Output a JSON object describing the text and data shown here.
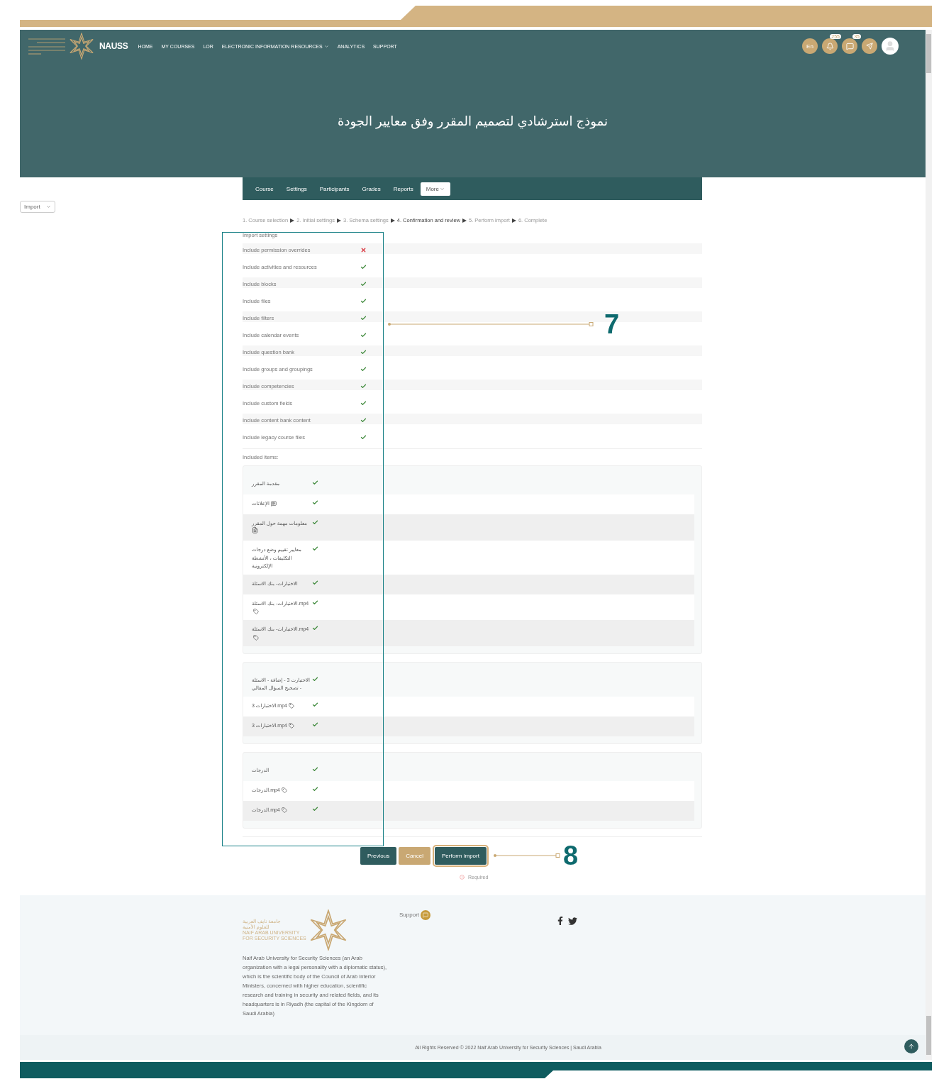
{
  "header": {
    "site_name": "NAUSS",
    "nav": [
      {
        "label": "HOME",
        "dropdown": false
      },
      {
        "label": "MY COURSES",
        "dropdown": false
      },
      {
        "label": "LOR",
        "dropdown": false
      },
      {
        "label": "ELECTRONIC INFORMATION RESOURCES",
        "dropdown": true
      },
      {
        "label": "ANALYTICS",
        "dropdown": false
      },
      {
        "label": "SUPPORT",
        "dropdown": false
      }
    ],
    "language": "En",
    "notifications": "255",
    "messages": "35"
  },
  "page_title": "نموذج استرشادي لتصميم المقرر وفق معايير الجودة",
  "course_nav": [
    {
      "label": "Course",
      "selected": false,
      "dropdown": false
    },
    {
      "label": "Settings",
      "selected": false,
      "dropdown": false
    },
    {
      "label": "Participants",
      "selected": false,
      "dropdown": false
    },
    {
      "label": "Grades",
      "selected": false,
      "dropdown": false
    },
    {
      "label": "Reports",
      "selected": false,
      "dropdown": false
    },
    {
      "label": "More",
      "selected": true,
      "dropdown": true
    }
  ],
  "import_select": "Import",
  "steps": [
    {
      "label": "1. Course selection",
      "current": false
    },
    {
      "label": "2. Initial settings",
      "current": false
    },
    {
      "label": "3. Schema settings",
      "current": false
    },
    {
      "label": "4. Confirmation and review",
      "current": true
    },
    {
      "label": "5. Perform import",
      "current": false
    },
    {
      "label": "6. Complete",
      "current": false
    }
  ],
  "import_settings": {
    "heading": "Import settings",
    "items": [
      {
        "label": "Include permission overrides",
        "checked": false
      },
      {
        "label": "Include activities and resources",
        "checked": true
      },
      {
        "label": "Include blocks",
        "checked": true
      },
      {
        "label": "Include files",
        "checked": true
      },
      {
        "label": "Include filters",
        "checked": true
      },
      {
        "label": "Include calendar events",
        "checked": true
      },
      {
        "label": "Include question bank",
        "checked": true
      },
      {
        "label": "Include groups and groupings",
        "checked": true
      },
      {
        "label": "Include competencies",
        "checked": true
      },
      {
        "label": "Include custom fields",
        "checked": true
      },
      {
        "label": "Include content bank content",
        "checked": true
      },
      {
        "label": "Include legacy course files",
        "checked": true
      }
    ]
  },
  "included_items": {
    "heading": "Included items:",
    "sections": [
      {
        "items": [
          {
            "label": "مقدمة المقرر",
            "kind": "section",
            "checked": true
          },
          {
            "label": "الإعلانات",
            "kind": "forum",
            "checked": true
          },
          {
            "label": "معلومات مهمة حول المقرر",
            "kind": "page",
            "checked": true
          },
          {
            "label": "معايير تقييم وضع درجات التكليفات ، الأنشطة الإلكترونية",
            "kind": "section",
            "checked": true
          },
          {
            "label": "الاختبارات- بنك الاسئلة",
            "kind": "section",
            "checked": true
          },
          {
            "label": "الاختبارات- بنك الاسئلة.mp4",
            "kind": "tag",
            "checked": true
          },
          {
            "label": "الاختبارات- بنك الاسئلة.mp4",
            "kind": "tag",
            "checked": true
          }
        ]
      },
      {
        "items": [
          {
            "label": "الاختبارت 3 - إضافة - الاسئلة - تصحيح السؤال المقالي",
            "kind": "section",
            "checked": true
          },
          {
            "label": "الاختبارات 3.mp4",
            "kind": "tag",
            "checked": true
          },
          {
            "label": "الاختبارات 3.mp4",
            "kind": "tag",
            "checked": true
          }
        ]
      },
      {
        "items": [
          {
            "label": "الدرجات",
            "kind": "section",
            "checked": true
          },
          {
            "label": "الدرجات.mp4",
            "kind": "tag",
            "checked": true
          },
          {
            "label": "الدرجات.mp4",
            "kind": "tag",
            "checked": true
          }
        ]
      }
    ]
  },
  "buttons": [
    {
      "label": "Previous",
      "kind": "secondary"
    },
    {
      "label": "Cancel",
      "kind": "cancel"
    },
    {
      "label": "Perform import",
      "kind": "primary"
    }
  ],
  "required_note": "Required",
  "annotations": [
    "7",
    "8"
  ],
  "footer": {
    "logo_lines": [
      "جامعة نايف العربية",
      "للعلوم الأمنية",
      "NAIF ARAB UNIVERSITY",
      "FOR SECURITY SCIENCES"
    ],
    "description": "Naif Arab University for Security Sciences (an Arab organization with a legal personality with a diplomatic status), which is the scientific body of the Council of Arab Interior Ministers, concerned with higher education, scientific research and training in security and related fields, and its headquarters is in Riyadh (the capital of the Kingdom of Saudi Arabia)",
    "support": "Support",
    "copyright": "All Rights Reserved © 2022 Naif Arab University for Security Sciences | Saudi Arabia"
  }
}
